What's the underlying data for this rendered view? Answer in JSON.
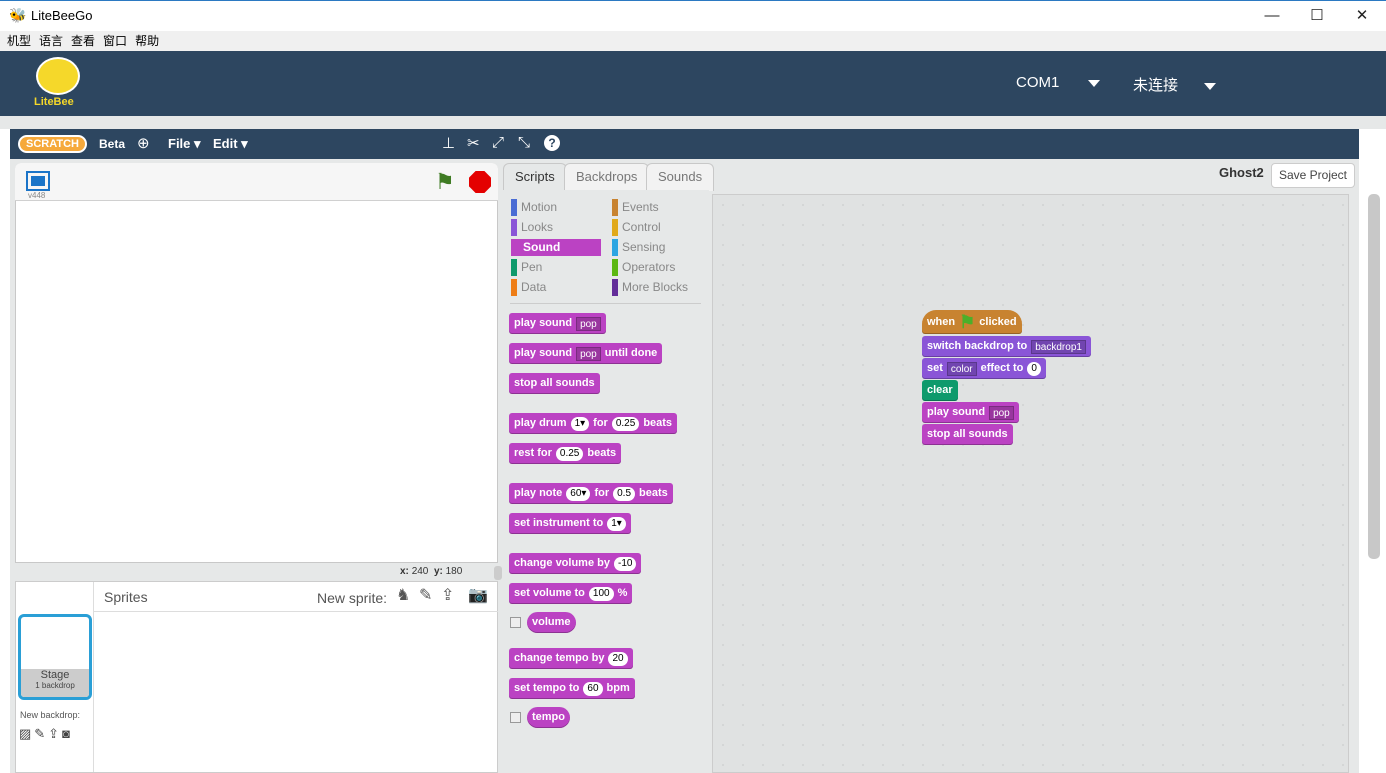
{
  "window": {
    "title": "LiteBeeGo",
    "minimize": "—",
    "maximize": "☐",
    "close": "✕"
  },
  "menu": [
    "机型",
    "语言",
    "查看",
    "窗口",
    "帮助"
  ],
  "banner": {
    "logo_text": "LiteBee",
    "port": "COM1",
    "status": "未连接"
  },
  "toolbar": {
    "logo": "SCRATCH",
    "beta": "Beta",
    "file": "File ▾",
    "edit": "Edit ▾",
    "icons": [
      "stamp-icon",
      "cut-icon",
      "grow-icon",
      "shrink-icon",
      "help-icon"
    ]
  },
  "stage": {
    "version": "v448",
    "x_label": "x:",
    "x": "240",
    "y_label": "y:",
    "y": "180"
  },
  "sprites": {
    "title": "Sprites",
    "new_sprite": "New sprite:",
    "stage_label": "Stage",
    "stage_sub": "1 backdrop",
    "new_backdrop": "New backdrop:"
  },
  "tabs": [
    "Scripts",
    "Backdrops",
    "Sounds"
  ],
  "sprite_name": "Ghost2",
  "save": "Save Project",
  "categories": [
    {
      "label": "Motion",
      "color": "#4a6cd4"
    },
    {
      "label": "Events",
      "color": "#c88330"
    },
    {
      "label": "Looks",
      "color": "#8a55d7"
    },
    {
      "label": "Control",
      "color": "#e1a91a"
    },
    {
      "label": "Sound",
      "color": "#bb42c3",
      "selected": true
    },
    {
      "label": "Sensing",
      "color": "#2ca5e2"
    },
    {
      "label": "Pen",
      "color": "#0e9a6c"
    },
    {
      "label": "Operators",
      "color": "#5cb712"
    },
    {
      "label": "Data",
      "color": "#ee7d16"
    },
    {
      "label": "More Blocks",
      "color": "#632d99"
    }
  ],
  "palette_blocks": [
    [
      {
        "t": "play sound"
      },
      {
        "d": "pop"
      }
    ],
    [
      {
        "t": "play sound"
      },
      {
        "d": "pop"
      },
      {
        "t": "until done"
      }
    ],
    [
      {
        "t": "stop all sounds"
      }
    ],
    [
      {
        "t": "play drum"
      },
      {
        "n": "1▾"
      },
      {
        "t": "for"
      },
      {
        "n": "0.25"
      },
      {
        "t": "beats"
      }
    ],
    [
      {
        "t": "rest for"
      },
      {
        "n": "0.25"
      },
      {
        "t": "beats"
      }
    ],
    [
      {
        "t": "play note"
      },
      {
        "n": "60▾"
      },
      {
        "t": "for"
      },
      {
        "n": "0.5"
      },
      {
        "t": "beats"
      }
    ],
    [
      {
        "t": "set instrument to"
      },
      {
        "n": "1▾"
      }
    ],
    [
      {
        "t": "change volume by"
      },
      {
        "n": "-10"
      }
    ],
    [
      {
        "t": "set volume to"
      },
      {
        "n": "100"
      },
      {
        "t": "%"
      }
    ],
    [
      {
        "t": "volume"
      }
    ],
    [
      {
        "t": "change tempo by"
      },
      {
        "n": "20"
      }
    ],
    [
      {
        "t": "set tempo to"
      },
      {
        "n": "60"
      },
      {
        "t": "bpm"
      }
    ],
    [
      {
        "t": "tempo"
      }
    ]
  ],
  "script": [
    {
      "cls": "ev",
      "parts": [
        {
          "t": "when"
        },
        {
          "f": "⚑"
        },
        {
          "t": "clicked"
        }
      ]
    },
    {
      "cls": "looks",
      "parts": [
        {
          "t": "switch backdrop to"
        },
        {
          "d": "backdrop1"
        }
      ]
    },
    {
      "cls": "looks",
      "parts": [
        {
          "t": "set"
        },
        {
          "d": "color"
        },
        {
          "t": "effect to"
        },
        {
          "n": "0"
        }
      ]
    },
    {
      "cls": "pen",
      "parts": [
        {
          "t": "clear"
        }
      ]
    },
    {
      "cls": "snd",
      "parts": [
        {
          "t": "play sound"
        },
        {
          "d": "pop"
        }
      ]
    },
    {
      "cls": "snd",
      "parts": [
        {
          "t": "stop all sounds"
        }
      ]
    }
  ]
}
